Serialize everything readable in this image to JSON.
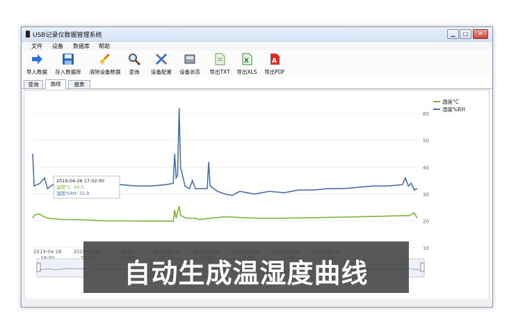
{
  "window": {
    "title": "USB记录仪数据管理系统",
    "min": "▁",
    "max": "□",
    "close": "✕"
  },
  "menu": [
    "文件",
    "设备",
    "数据库",
    "帮助"
  ],
  "toolbar": [
    {
      "label": "导入数据",
      "icon": "import-arrow-icon"
    },
    {
      "label": "存入数据库",
      "icon": "save-disk-icon"
    },
    {
      "label": "清除设备数据",
      "icon": "broom-icon"
    },
    {
      "label": "查询",
      "icon": "magnifier-icon"
    },
    {
      "label": "设备配置",
      "icon": "wrench-screwdriver-icon"
    },
    {
      "label": "设备状态",
      "icon": "device-icon"
    },
    {
      "label": "导出TXT",
      "icon": "txt-file-icon"
    },
    {
      "label": "导出XLS",
      "icon": "xls-file-icon"
    },
    {
      "label": "导出PDF",
      "icon": "pdf-file-icon"
    }
  ],
  "tabs": [
    "查询",
    "曲线",
    "报表"
  ],
  "active_tab": "曲线",
  "tooltip": {
    "time": "2019-04-26 17:02:00",
    "temp": "温度°C: 24.5",
    "hum": "湿度%RH: 31.9"
  },
  "overlay_text": "自动生成温湿度曲线",
  "chart_data": {
    "type": "line",
    "legend_position": "top-right",
    "series": [
      {
        "name": "温度°C",
        "color": "#7fb33e",
        "values": [
          [
            0,
            21
          ],
          [
            1,
            22
          ],
          [
            3,
            22.5
          ],
          [
            5,
            22.5
          ],
          [
            6,
            22
          ],
          [
            10,
            21
          ],
          [
            20,
            20.5
          ],
          [
            30,
            20.5
          ],
          [
            50,
            20
          ],
          [
            60,
            20
          ],
          [
            80,
            19.9
          ],
          [
            95,
            19.9
          ],
          [
            96,
            24
          ],
          [
            97,
            21
          ],
          [
            99,
            25.5
          ],
          [
            100,
            22
          ],
          [
            104,
            21
          ],
          [
            110,
            21
          ],
          [
            112,
            20.5
          ],
          [
            130,
            21.5
          ],
          [
            150,
            21
          ],
          [
            170,
            21
          ],
          [
            190,
            21.2
          ],
          [
            220,
            21.5
          ],
          [
            255,
            22
          ],
          [
            258,
            23
          ],
          [
            260,
            21
          ]
        ]
      },
      {
        "name": "湿度%RH",
        "color": "#4a6fa5",
        "values": [
          [
            0,
            45
          ],
          [
            1,
            33
          ],
          [
            5,
            34
          ],
          [
            8,
            36
          ],
          [
            10,
            32
          ],
          [
            20,
            36
          ],
          [
            30,
            35.5
          ],
          [
            40,
            35
          ],
          [
            50,
            34
          ],
          [
            60,
            33.5
          ],
          [
            70,
            33
          ],
          [
            80,
            33
          ],
          [
            90,
            33.5
          ],
          [
            95,
            34
          ],
          [
            96,
            45
          ],
          [
            97,
            36
          ],
          [
            98,
            37
          ],
          [
            99,
            62
          ],
          [
            100,
            40
          ],
          [
            103,
            33
          ],
          [
            106,
            32
          ],
          [
            108,
            35
          ],
          [
            110,
            32
          ],
          [
            118,
            32
          ],
          [
            119,
            42
          ],
          [
            120,
            33
          ],
          [
            125,
            31
          ],
          [
            130,
            30
          ],
          [
            135,
            29.5
          ],
          [
            140,
            31
          ],
          [
            150,
            30
          ],
          [
            160,
            31
          ],
          [
            170,
            30.5
          ],
          [
            180,
            31.5
          ],
          [
            190,
            31.5
          ],
          [
            200,
            32
          ],
          [
            210,
            32
          ],
          [
            220,
            32.5
          ],
          [
            230,
            33
          ],
          [
            240,
            33
          ],
          [
            250,
            33.5
          ],
          [
            252,
            36
          ],
          [
            254,
            33
          ],
          [
            256,
            34
          ],
          [
            258,
            31.5
          ],
          [
            260,
            32
          ]
        ]
      }
    ],
    "y_ticks": [
      10,
      20,
      30,
      40,
      50,
      60
    ],
    "ylim": [
      10,
      66
    ],
    "x_ticks": [
      {
        "x": 10,
        "l1": "2019-04-26",
        "l2": "18:00"
      },
      {
        "x": 37,
        "l1": "2019-04-26",
        "l2": "21:00"
      },
      {
        "x": 64,
        "l1": "2019",
        "l2": "04-27"
      },
      {
        "x": 91,
        "l1": "2019-04-27",
        "l2": "03:00"
      },
      {
        "x": 118,
        "l1": "2019-04-27",
        "l2": "06:00"
      },
      {
        "x": 145,
        "l1": "2019-04-27",
        "l2": "09:00"
      },
      {
        "x": 172,
        "l1": "2019-04-27",
        "l2": "12:00"
      },
      {
        "x": 199,
        "l1": "2019-04-27",
        "l2": "15:00"
      }
    ],
    "xlim": [
      0,
      260
    ]
  },
  "colors": {
    "temp": "#7fb33e",
    "hum": "#4a6fa5",
    "overlay": "#3c3c3c"
  }
}
